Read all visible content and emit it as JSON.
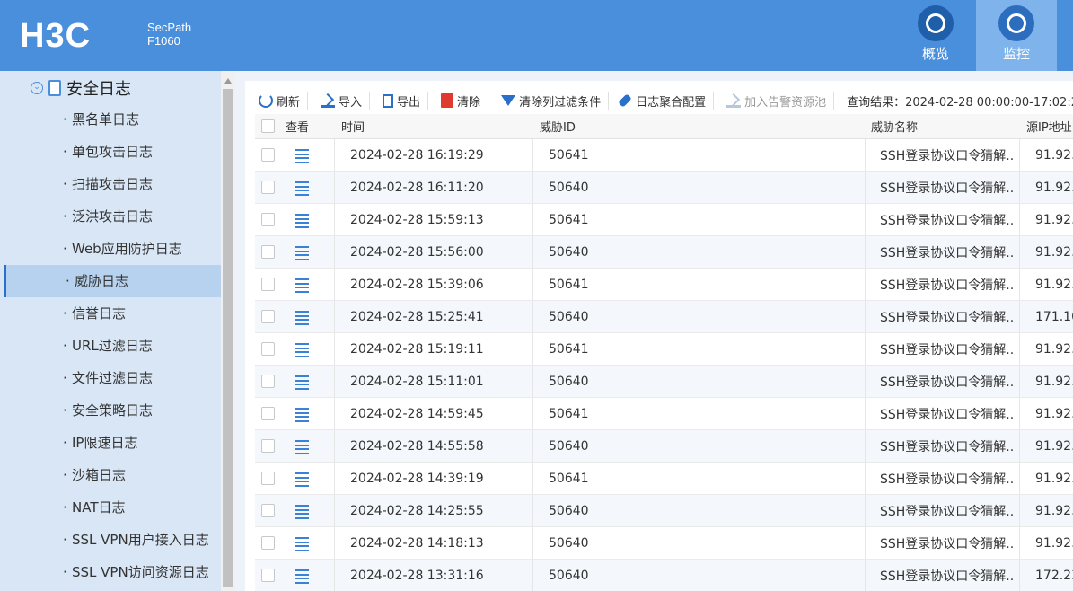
{
  "header": {
    "logo": "H3C",
    "product_line1": "SecPath",
    "product_line2": "F1060",
    "nav": [
      {
        "label": "概览",
        "icon": "dashboard-icon"
      },
      {
        "label": "监控",
        "icon": "monitor-icon",
        "active": true
      }
    ]
  },
  "sidebar": {
    "section_title": "安全日志",
    "items": [
      {
        "label": "黑名单日志"
      },
      {
        "label": "单包攻击日志"
      },
      {
        "label": "扫描攻击日志"
      },
      {
        "label": "泛洪攻击日志"
      },
      {
        "label": "Web应用防护日志"
      },
      {
        "label": "威胁日志",
        "active": true
      },
      {
        "label": "信誉日志"
      },
      {
        "label": "URL过滤日志"
      },
      {
        "label": "文件过滤日志"
      },
      {
        "label": "安全策略日志"
      },
      {
        "label": "IP限速日志"
      },
      {
        "label": "沙箱日志"
      },
      {
        "label": "NAT日志"
      },
      {
        "label": "SSL VPN用户接入日志"
      },
      {
        "label": "SSL VPN访问资源日志"
      }
    ]
  },
  "toolbar": {
    "refresh": "刷新",
    "import": "导入",
    "export": "导出",
    "clear": "清除",
    "clear_filter": "清除列过滤条件",
    "log_aggregation": "日志聚合配置",
    "add_alarm_pool": "加入告警资源池",
    "query_result": "查询结果：2024-02-28 00:00:00-17:02:2"
  },
  "table": {
    "columns": {
      "view": "查看",
      "time": "时间",
      "threat_id": "威胁ID",
      "threat_name": "威胁名称",
      "src_ip": "源IP地址"
    },
    "rows": [
      {
        "time": "2024-02-28 16:19:29",
        "id": "50641",
        "name": "SSH登录协议口令猜解...",
        "ip": "91.92.2"
      },
      {
        "time": "2024-02-28 16:11:20",
        "id": "50640",
        "name": "SSH登录协议口令猜解...",
        "ip": "91.92.2"
      },
      {
        "time": "2024-02-28 15:59:13",
        "id": "50641",
        "name": "SSH登录协议口令猜解...",
        "ip": "91.92.2"
      },
      {
        "time": "2024-02-28 15:56:00",
        "id": "50640",
        "name": "SSH登录协议口令猜解...",
        "ip": "91.92.2"
      },
      {
        "time": "2024-02-28 15:39:06",
        "id": "50641",
        "name": "SSH登录协议口令猜解...",
        "ip": "91.92.2"
      },
      {
        "time": "2024-02-28 15:25:41",
        "id": "50640",
        "name": "SSH登录协议口令猜解...",
        "ip": "171.10"
      },
      {
        "time": "2024-02-28 15:19:11",
        "id": "50641",
        "name": "SSH登录协议口令猜解...",
        "ip": "91.92.2"
      },
      {
        "time": "2024-02-28 15:11:01",
        "id": "50640",
        "name": "SSH登录协议口令猜解...",
        "ip": "91.92.2"
      },
      {
        "time": "2024-02-28 14:59:45",
        "id": "50641",
        "name": "SSH登录协议口令猜解...",
        "ip": "91.92.2"
      },
      {
        "time": "2024-02-28 14:55:58",
        "id": "50640",
        "name": "SSH登录协议口令猜解...",
        "ip": "91.92.2"
      },
      {
        "time": "2024-02-28 14:39:19",
        "id": "50641",
        "name": "SSH登录协议口令猜解...",
        "ip": "91.92.2"
      },
      {
        "time": "2024-02-28 14:25:55",
        "id": "50640",
        "name": "SSH登录协议口令猜解...",
        "ip": "91.92.2"
      },
      {
        "time": "2024-02-28 14:18:13",
        "id": "50640",
        "name": "SSH登录协议口令猜解...",
        "ip": "91.92.2"
      },
      {
        "time": "2024-02-28 13:31:16",
        "id": "50640",
        "name": "SSH登录协议口令猜解...",
        "ip": "172.23"
      }
    ]
  }
}
